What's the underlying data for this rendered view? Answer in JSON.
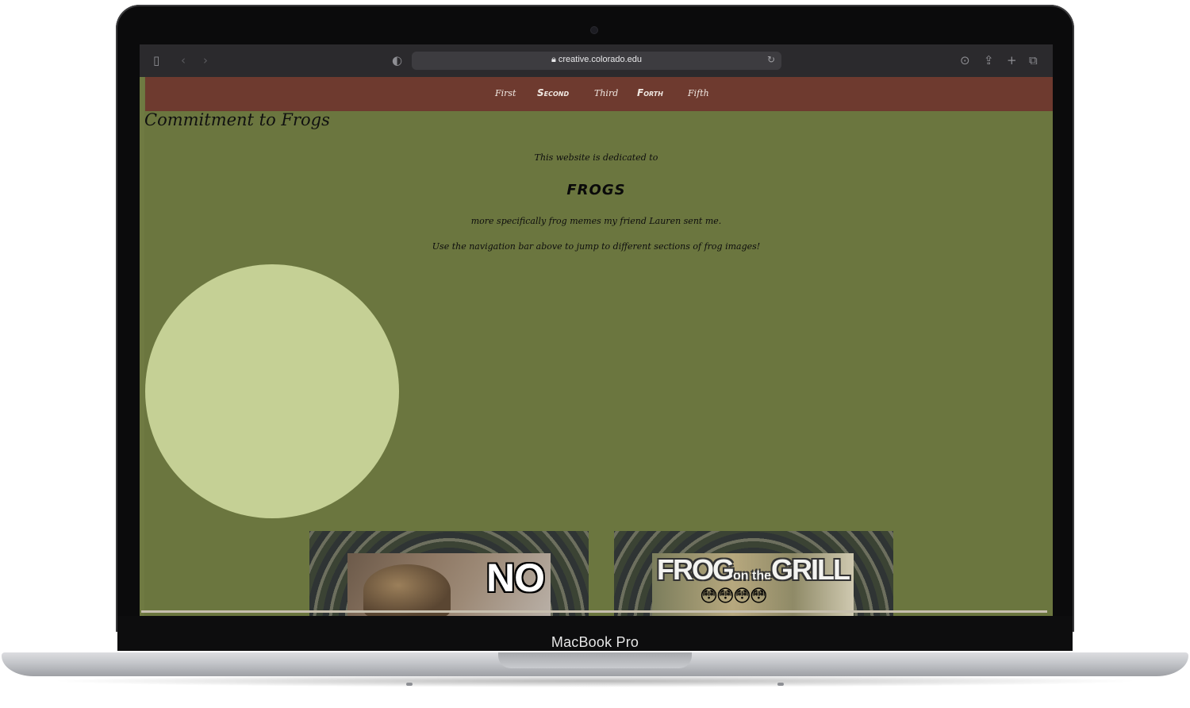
{
  "device": {
    "label": "MacBook Pro"
  },
  "browser": {
    "url": "creative.colorado.edu",
    "icons": [
      "sidebar-icon",
      "back-icon",
      "forward-icon",
      "privacy-shield-icon",
      "lock-icon",
      "reload-icon",
      "download-icon",
      "share-icon",
      "new-tab-icon",
      "tabs-overview-icon"
    ]
  },
  "nav": {
    "items": [
      {
        "label": "First"
      },
      {
        "label": "Second"
      },
      {
        "label": "Third"
      },
      {
        "label": "Forth"
      },
      {
        "label": "Fifth"
      }
    ]
  },
  "page": {
    "title": "Commitment to Frogs",
    "intro": "This website is dedicated to",
    "heading": "FROGS",
    "line2": "more specifically frog memes my friend Lauren sent me.",
    "line3": "Use the navigation bar above to jump to different sections of frog images!"
  },
  "memes": [
    {
      "caption": "NO"
    },
    {
      "caption_main": "FROG",
      "caption_small": "on the",
      "caption_end": "GRILL",
      "emoji": "😳😳😳😳"
    }
  ],
  "colors": {
    "page_bg": "#6b763f",
    "nav_bg": "#6e3a2f",
    "circle": "#c5d095"
  }
}
